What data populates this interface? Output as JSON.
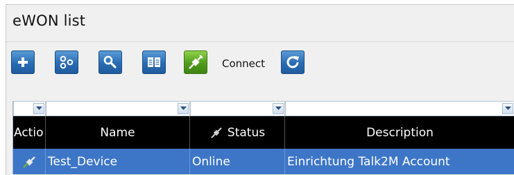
{
  "window": {
    "title": "eWON list"
  },
  "toolbar": {
    "buttons": [
      {
        "icon": "plus-icon"
      },
      {
        "icon": "group-icon"
      },
      {
        "icon": "search-icon"
      },
      {
        "icon": "book-icon"
      },
      {
        "icon": "connect-plug-icon",
        "label": "Connect"
      },
      {
        "icon": "refresh-icon"
      }
    ]
  },
  "grid": {
    "columns": [
      {
        "label": "Actio"
      },
      {
        "label": "Name"
      },
      {
        "label": "Status"
      },
      {
        "label": "Description"
      }
    ],
    "rows": [
      {
        "name": "Test_Device",
        "status": "Online",
        "description": "Einrichtung Talk2M Account",
        "selected": true
      }
    ]
  },
  "colors": {
    "toolbar_button": "#2a6cb3",
    "connect_button": "#4f9a1c",
    "header_bg": "#000000",
    "selected_row": "#3d76c7"
  }
}
